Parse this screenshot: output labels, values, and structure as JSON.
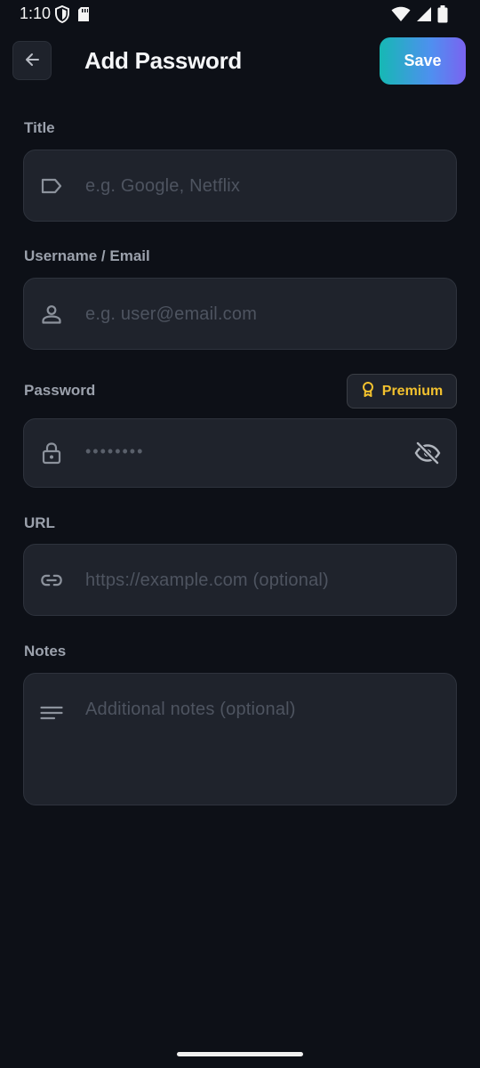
{
  "status_bar": {
    "time": "1:10",
    "left_icons": [
      "shield-icon",
      "sd-card-icon"
    ],
    "right_icons": [
      "wifi-icon",
      "signal-icon",
      "battery-icon"
    ]
  },
  "header": {
    "back_icon": "arrow-left-icon",
    "title": "Add Password",
    "save_label": "Save"
  },
  "form": {
    "title": {
      "label": "Title",
      "placeholder": "e.g. Google, Netflix",
      "icon": "tag-icon"
    },
    "username": {
      "label": "Username / Email",
      "placeholder": "e.g. user@email.com",
      "icon": "person-icon"
    },
    "password": {
      "label": "Password",
      "placeholder": "••••••••",
      "icon": "lock-icon",
      "toggle_icon": "eye-off-icon",
      "premium_label": "Premium",
      "premium_icon": "award-icon"
    },
    "url": {
      "label": "URL",
      "placeholder": "https://example.com (optional)",
      "icon": "link-icon"
    },
    "notes": {
      "label": "Notes",
      "placeholder": "Additional notes (optional)",
      "icon": "notes-icon"
    }
  },
  "colors": {
    "background": "#0d1017",
    "field_bg": "#1f232c",
    "accent_start": "#16b8b4",
    "accent_end": "#7a63f0",
    "premium": "#f2c12e"
  }
}
